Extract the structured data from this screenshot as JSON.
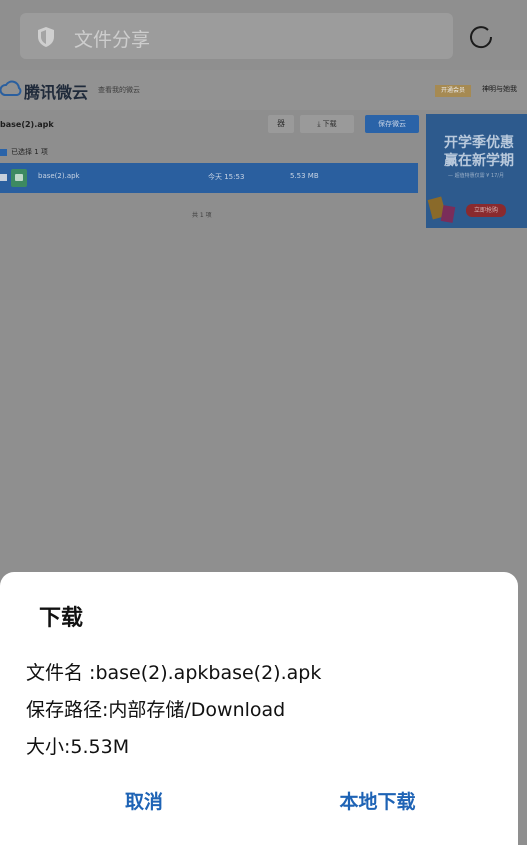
{
  "browser": {
    "url_text": "文件分享",
    "security_icon": "shield-icon",
    "reload_icon": "reload-icon"
  },
  "page": {
    "brand": "腾讯微云",
    "sublink": "查看我的微云",
    "vip_label": "开通会员",
    "user_name": "神明与她我",
    "filename_header": "base(2).apk",
    "qr_label": "器",
    "download_label": "下载",
    "save_label": "保存微云",
    "selected_text": "已选择 1 项",
    "file_row": {
      "name": "base(2).apk",
      "date": "今天 15:53",
      "size": "5.53 MB"
    },
    "total_text": "共 1 项",
    "ad": {
      "line1": "开学季优惠",
      "line2": "赢在新学期",
      "line3": "— 超值特惠仅需 ¥ 17/月",
      "button": "立即抢购"
    }
  },
  "dialog": {
    "title": "下载",
    "filename_line": "文件名 :base(2).apkbase(2).apk",
    "path_line": "保存路径:内部存储/Download",
    "size_line": "大小:5.53M",
    "cancel_label": "取消",
    "local_download_label": "本地下载"
  },
  "colors": {
    "overlay": "#8f8f8f",
    "accent_blue": "#1e63b5",
    "dialog_bg": "#ffffff"
  }
}
